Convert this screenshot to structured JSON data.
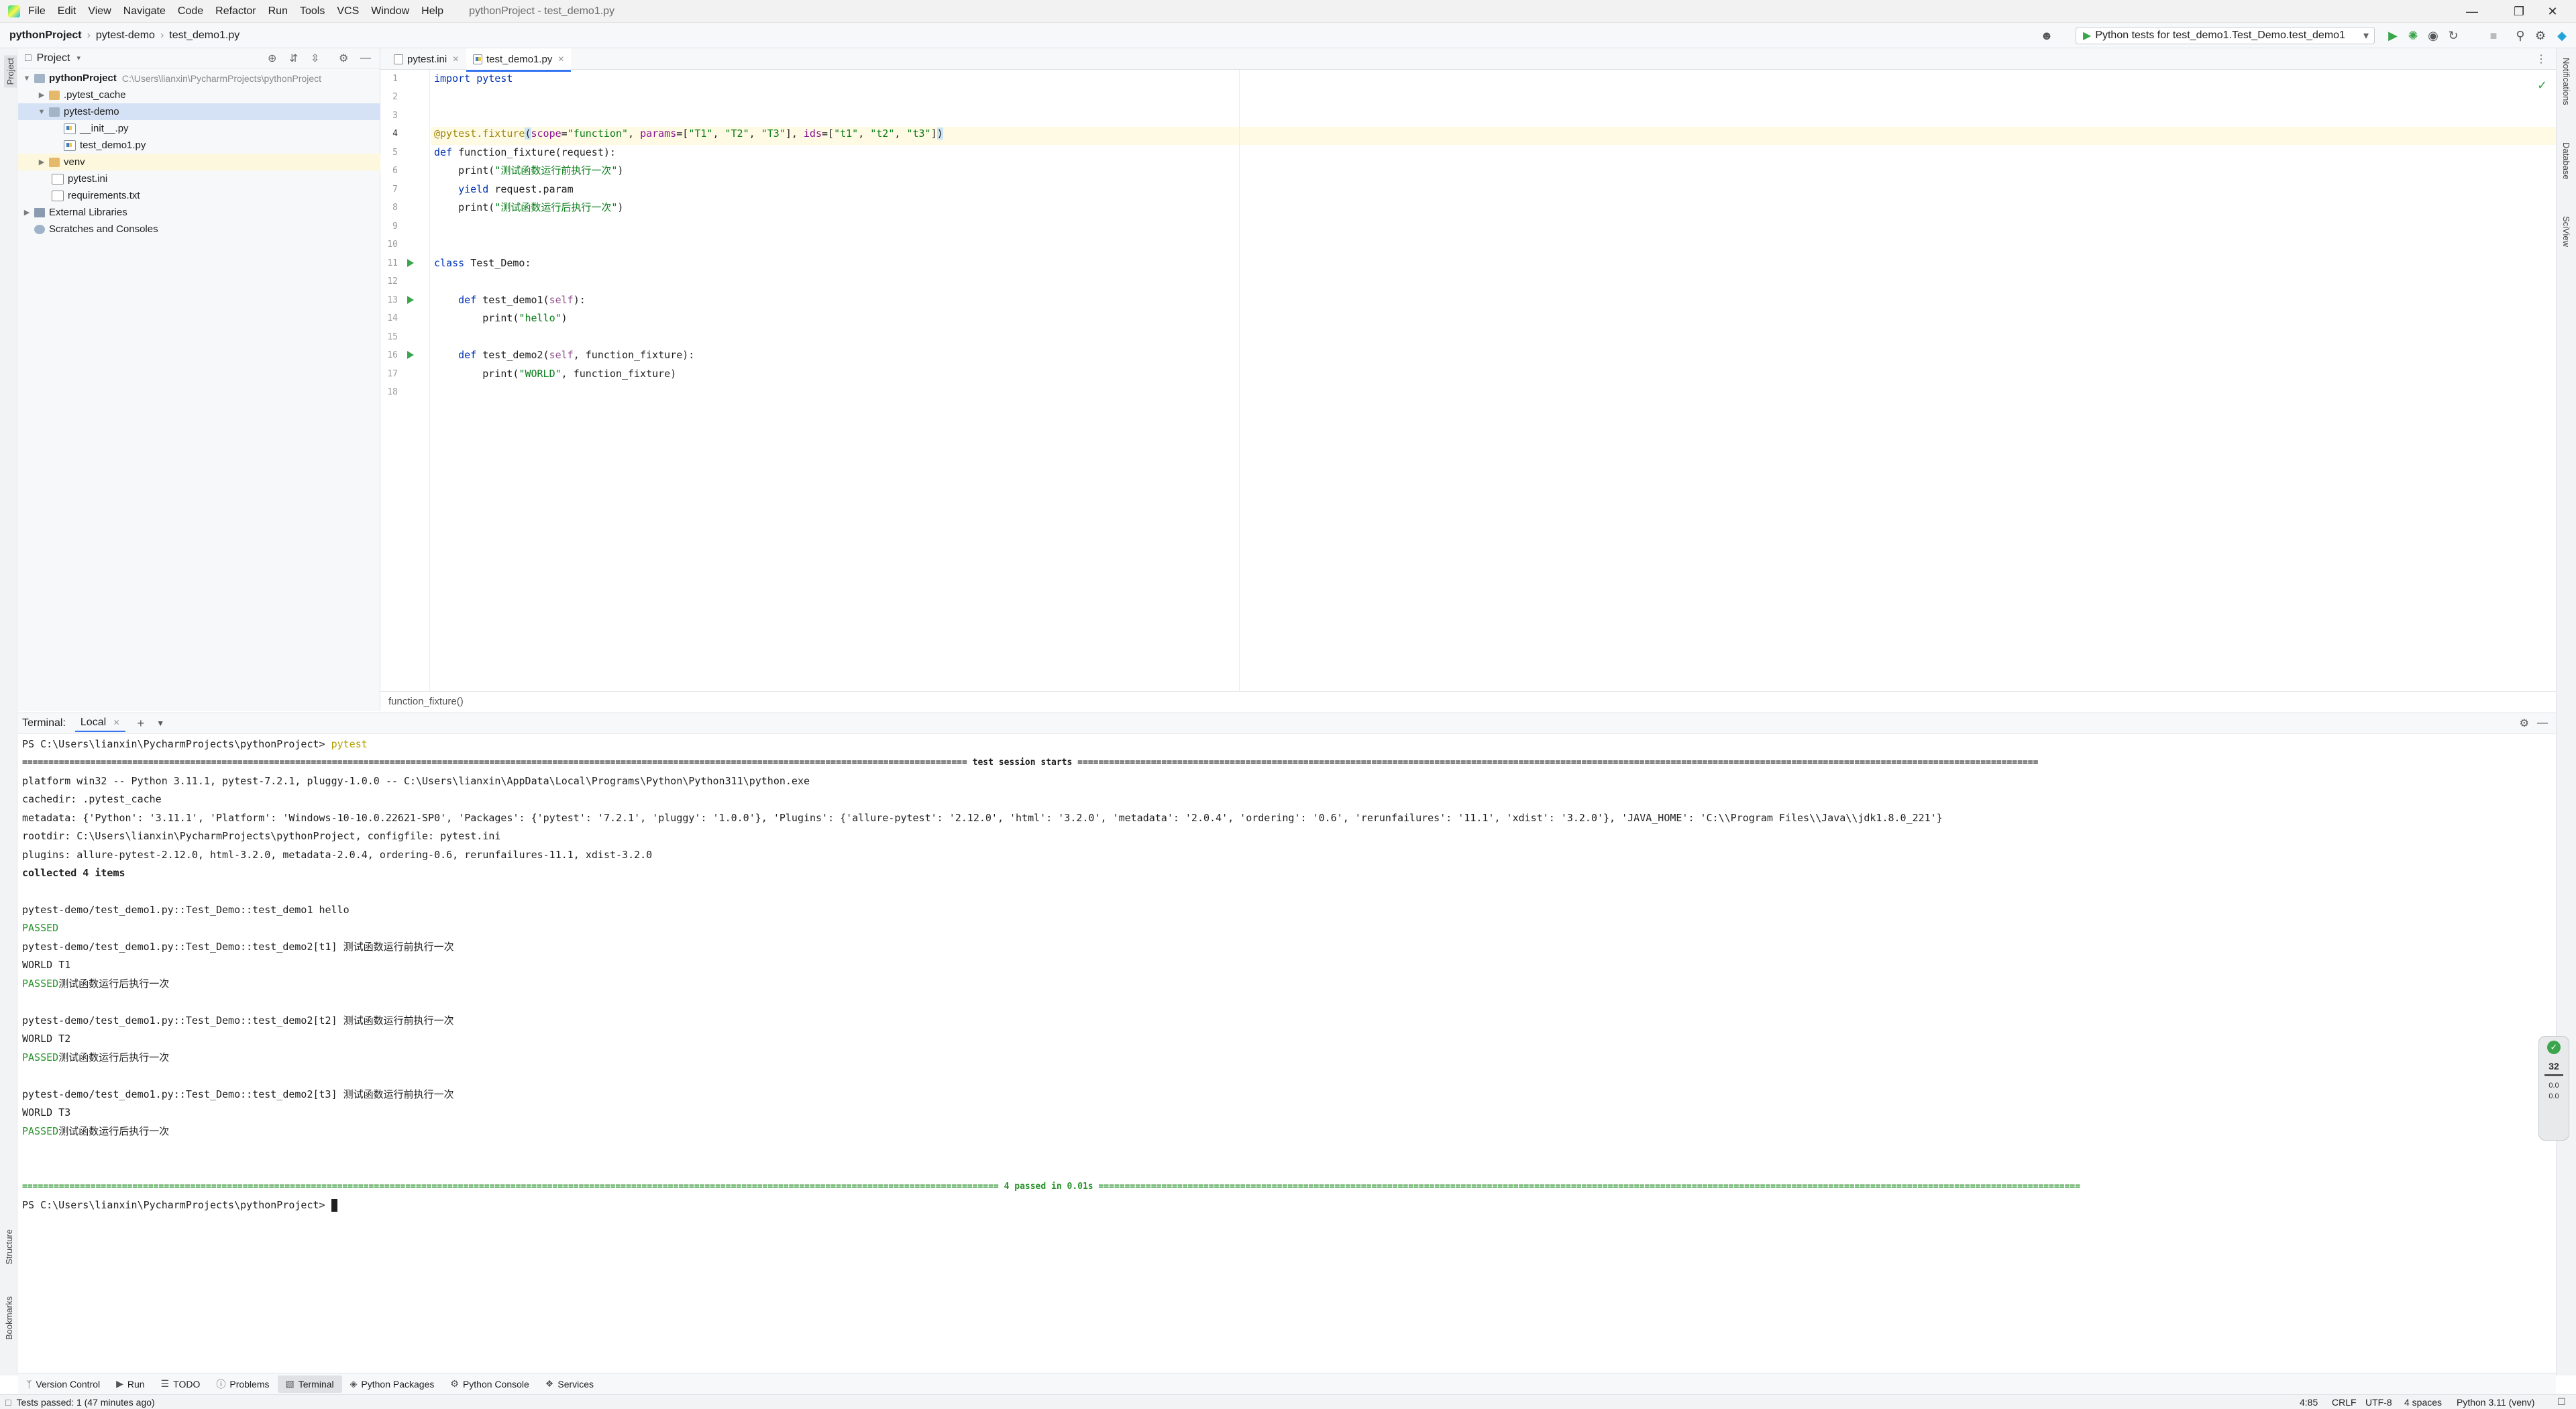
{
  "titlebar": {
    "menus": [
      "File",
      "Edit",
      "View",
      "Navigate",
      "Code",
      "Refactor",
      "Run",
      "Tools",
      "VCS",
      "Window",
      "Help"
    ],
    "window_title": "pythonProject - test_demo1.py"
  },
  "navbar": {
    "crumbs": [
      "pythonProject",
      "pytest-demo",
      "test_demo1.py"
    ],
    "run_config": "Python tests for test_demo1.Test_Demo.test_demo1"
  },
  "leftstrip": {
    "project": "Project",
    "structure": "Structure",
    "bookmarks": "Bookmarks"
  },
  "rightstrip": {
    "notifications": "Notifications",
    "database": "Database",
    "sciview": "SciView"
  },
  "project": {
    "header": "Project",
    "root_name": "pythonProject",
    "root_path": "C:\\Users\\lianxin\\PycharmProjects\\pythonProject",
    "items": [
      {
        "label": "pythonProject"
      },
      {
        "label": ".pytest_cache"
      },
      {
        "label": "pytest-demo"
      },
      {
        "label": "__init__.py"
      },
      {
        "label": "test_demo1.py"
      },
      {
        "label": "venv"
      },
      {
        "label": "pytest.ini"
      },
      {
        "label": "requirements.txt"
      },
      {
        "label": "External Libraries"
      },
      {
        "label": "Scratches and Consoles"
      }
    ]
  },
  "editor": {
    "tabs": [
      {
        "label": "pytest.ini"
      },
      {
        "label": "test_demo1.py"
      }
    ],
    "line_numbers": [
      "1",
      "2",
      "3",
      "4",
      "5",
      "6",
      "7",
      "8",
      "9",
      "10",
      "11",
      "12",
      "13",
      "14",
      "15",
      "16",
      "17",
      "18"
    ],
    "breadcrumb": "function_fixture()",
    "code": {
      "l1": "import pytest",
      "l4_dec": "@pytest.fixture",
      "l4_open": "(",
      "l4_scope_kw": "scope",
      "l4_scope_val": "\"function\"",
      "l4_params_kw": "params",
      "l4_params_val1": "\"T1\"",
      "l4_params_val2": "\"T2\"",
      "l4_params_val3": "\"T3\"",
      "l4_ids_kw": "ids",
      "l4_ids_val1": "\"t1\"",
      "l4_ids_val2": "\"t2\"",
      "l4_ids_val3": "\"t3\"",
      "l5_def": "def",
      "l5_rest": "function_fixture(request):",
      "l6_a": "print(",
      "l6_str": "\"测试函数运行前执行一次\"",
      "l6_b": ")",
      "l7_kw": "yield",
      "l7_rest": "request.param",
      "l8_a": "print(",
      "l8_str": "\"测试函数运行后执行一次\"",
      "l8_b": ")",
      "l11_kw": "class",
      "l11_rest": "Test_Demo:",
      "l13_def": "def",
      "l13_name": "test_demo1(",
      "l13_self": "self",
      "l13_end": "):",
      "l14_a": "print(",
      "l14_str": "\"hello\"",
      "l14_b": ")",
      "l16_def": "def",
      "l16_name": "test_demo2(",
      "l16_self": "self",
      "l16_end": ", function_fixture):",
      "l17_a": "print(",
      "l17_str": "\"WORLD\"",
      "l17_b": ", function_fixture)"
    }
  },
  "terminal": {
    "label": "Terminal:",
    "tab": "Local",
    "prompt": "PS C:\\Users\\lianxin\\PycharmProjects\\pythonProject>",
    "command": "pytest",
    "session_start": "==================================================================================================================================================================================== test session starts =======================================================================================================================================================================================",
    "platform": "platform win32 -- Python 3.11.1, pytest-7.2.1, pluggy-1.0.0 -- C:\\Users\\lianxin\\AppData\\Local\\Programs\\Python\\Python311\\python.exe",
    "cachedir": "cachedir: .pytest_cache",
    "metadata": "metadata: {'Python': '3.11.1', 'Platform': 'Windows-10-10.0.22621-SP0', 'Packages': {'pytest': '7.2.1', 'pluggy': '1.0.0'}, 'Plugins': {'allure-pytest': '2.12.0', 'html': '3.2.0', 'metadata': '2.0.4', 'ordering': '0.6', 'rerunfailures': '11.1', 'xdist': '3.2.0'}, 'JAVA_HOME': 'C:\\\\Program Files\\\\Java\\\\jdk1.8.0_221'}",
    "rootdir": "rootdir: C:\\Users\\lianxin\\PycharmProjects\\pythonProject, configfile: pytest.ini",
    "plugins": "plugins: allure-pytest-2.12.0, html-3.2.0, metadata-2.0.4, ordering-0.6, rerunfailures-11.1, xdist-3.2.0",
    "collected": "collected 4 items",
    "t1": "pytest-demo/test_demo1.py::Test_Demo::test_demo1 hello",
    "passed": "PASSED",
    "t2": "pytest-demo/test_demo1.py::Test_Demo::test_demo2[t1] 测试函数运行前执行一次",
    "w1": "WORLD T1",
    "after": "测试函数运行后执行一次",
    "t3": "pytest-demo/test_demo1.py::Test_Demo::test_demo2[t2] 测试函数运行前执行一次",
    "w2": "WORLD T2",
    "t4": "pytest-demo/test_demo1.py::Test_Demo::test_demo2[t3] 测试函数运行前执行一次",
    "w3": "WORLD T3",
    "summary": "========================================================================================================================================================================================== 4 passed in 0.01s ===========================================================================================================================================================================================",
    "prompt2": "PS C:\\Users\\lianxin\\PycharmProjects\\pythonProject>"
  },
  "bottom_tabs": [
    {
      "label": "Version Control"
    },
    {
      "label": "Run"
    },
    {
      "label": "TODO"
    },
    {
      "label": "Problems"
    },
    {
      "label": "Terminal"
    },
    {
      "label": "Python Packages"
    },
    {
      "label": "Python Console"
    },
    {
      "label": "Services"
    }
  ],
  "status": {
    "message": "Tests passed: 1 (47 minutes ago)",
    "position": "4:85",
    "line_sep": "CRLF",
    "encoding": "UTF-8",
    "indent": "4 spaces",
    "interpreter": "Python 3.11 (venv)"
  },
  "memory": {
    "value": "32",
    "line1": "0.0",
    "line2": "0.0"
  },
  "colors": {
    "accent": "#3574f0",
    "run_green": "#3aa54c",
    "passed_green": "#28922b"
  }
}
